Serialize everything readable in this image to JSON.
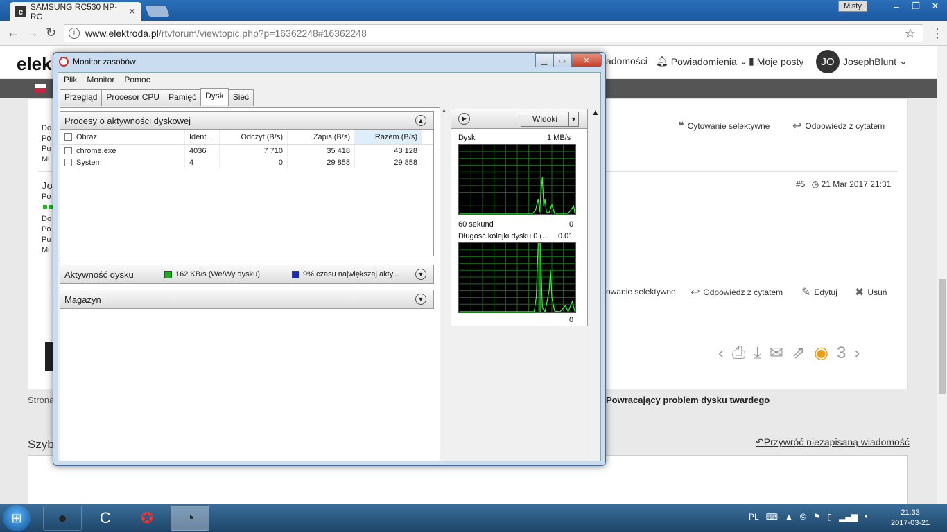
{
  "browser": {
    "tab_title": "SAMSUNG RC530 NP-RC",
    "tab_close": "✕",
    "user_label": "Misty",
    "url_host": "www.elektroda.pl",
    "url_path": "/rtvforum/viewtopic.php?p=16362248#16362248"
  },
  "site": {
    "logo": "elek",
    "nav": {
      "messages": "adomości",
      "notifications": "Powiadomienia",
      "my_posts": "Moje posty",
      "user": "JosephBlunt",
      "avatar": "JO"
    },
    "actions_top": {
      "quote": "Cytowanie selektywne",
      "reply": "Odpowiedz z cytatem"
    },
    "post": {
      "number": "#5",
      "date": "21 Mar 2017 21:31"
    },
    "actions_bottom": {
      "quote": "owanie selektywne",
      "reply": "Odpowiedz z cytatem",
      "edit": "Edytuj",
      "delete": "Usuń"
    },
    "side_labels": [
      "Do",
      "Po",
      "Pu",
      "Mi"
    ],
    "side_labels2": [
      "Jo",
      "Po",
      "Do",
      "Po",
      "Pu",
      "Mi"
    ],
    "views_count": "3",
    "strona": "Strona",
    "topic_title": "Powracający problem dysku twardego",
    "quick_reply": "Szyb",
    "restore_link": "Przywróć niezapisaną wiadomość"
  },
  "resmon": {
    "title": "Monitor zasobów",
    "menu": [
      "Plik",
      "Monitor",
      "Pomoc"
    ],
    "tabs": [
      "Przegląd",
      "Procesor CPU",
      "Pamięć",
      "Dysk",
      "Sieć"
    ],
    "active_tab": "Dysk",
    "processes": {
      "title": "Procesy o aktywności dyskowej",
      "columns": [
        "Obraz",
        "Ident...",
        "Odczyt (B/s)",
        "Zapis (B/s)",
        "Razem (B/s)"
      ],
      "rows": [
        {
          "image": "chrome.exe",
          "pid": "4036",
          "read": "7 710",
          "write": "35 418",
          "total": "43 128"
        },
        {
          "image": "System",
          "pid": "4",
          "read": "0",
          "write": "29 858",
          "total": "29 858"
        }
      ]
    },
    "activity": {
      "title": "Aktywność dysku",
      "legend1": "162 KB/s (We/Wy dysku)",
      "legend1_color": "#22aa22",
      "legend2": "9% czasu największej akty...",
      "legend2_color": "#1a2ab8"
    },
    "storage": {
      "title": "Magazyn"
    },
    "views_button": "Widoki",
    "disk_chart": {
      "label": "Dysk",
      "max": "1 MB/s",
      "xlabel": "60 sekund",
      "min": "0"
    },
    "queue_chart": {
      "label": "Długość kolejki dysku 0 (...",
      "max": "0.01",
      "min": "0"
    }
  },
  "taskbar": {
    "lang": "PL",
    "time": "21:33",
    "date": "2017-03-21"
  }
}
